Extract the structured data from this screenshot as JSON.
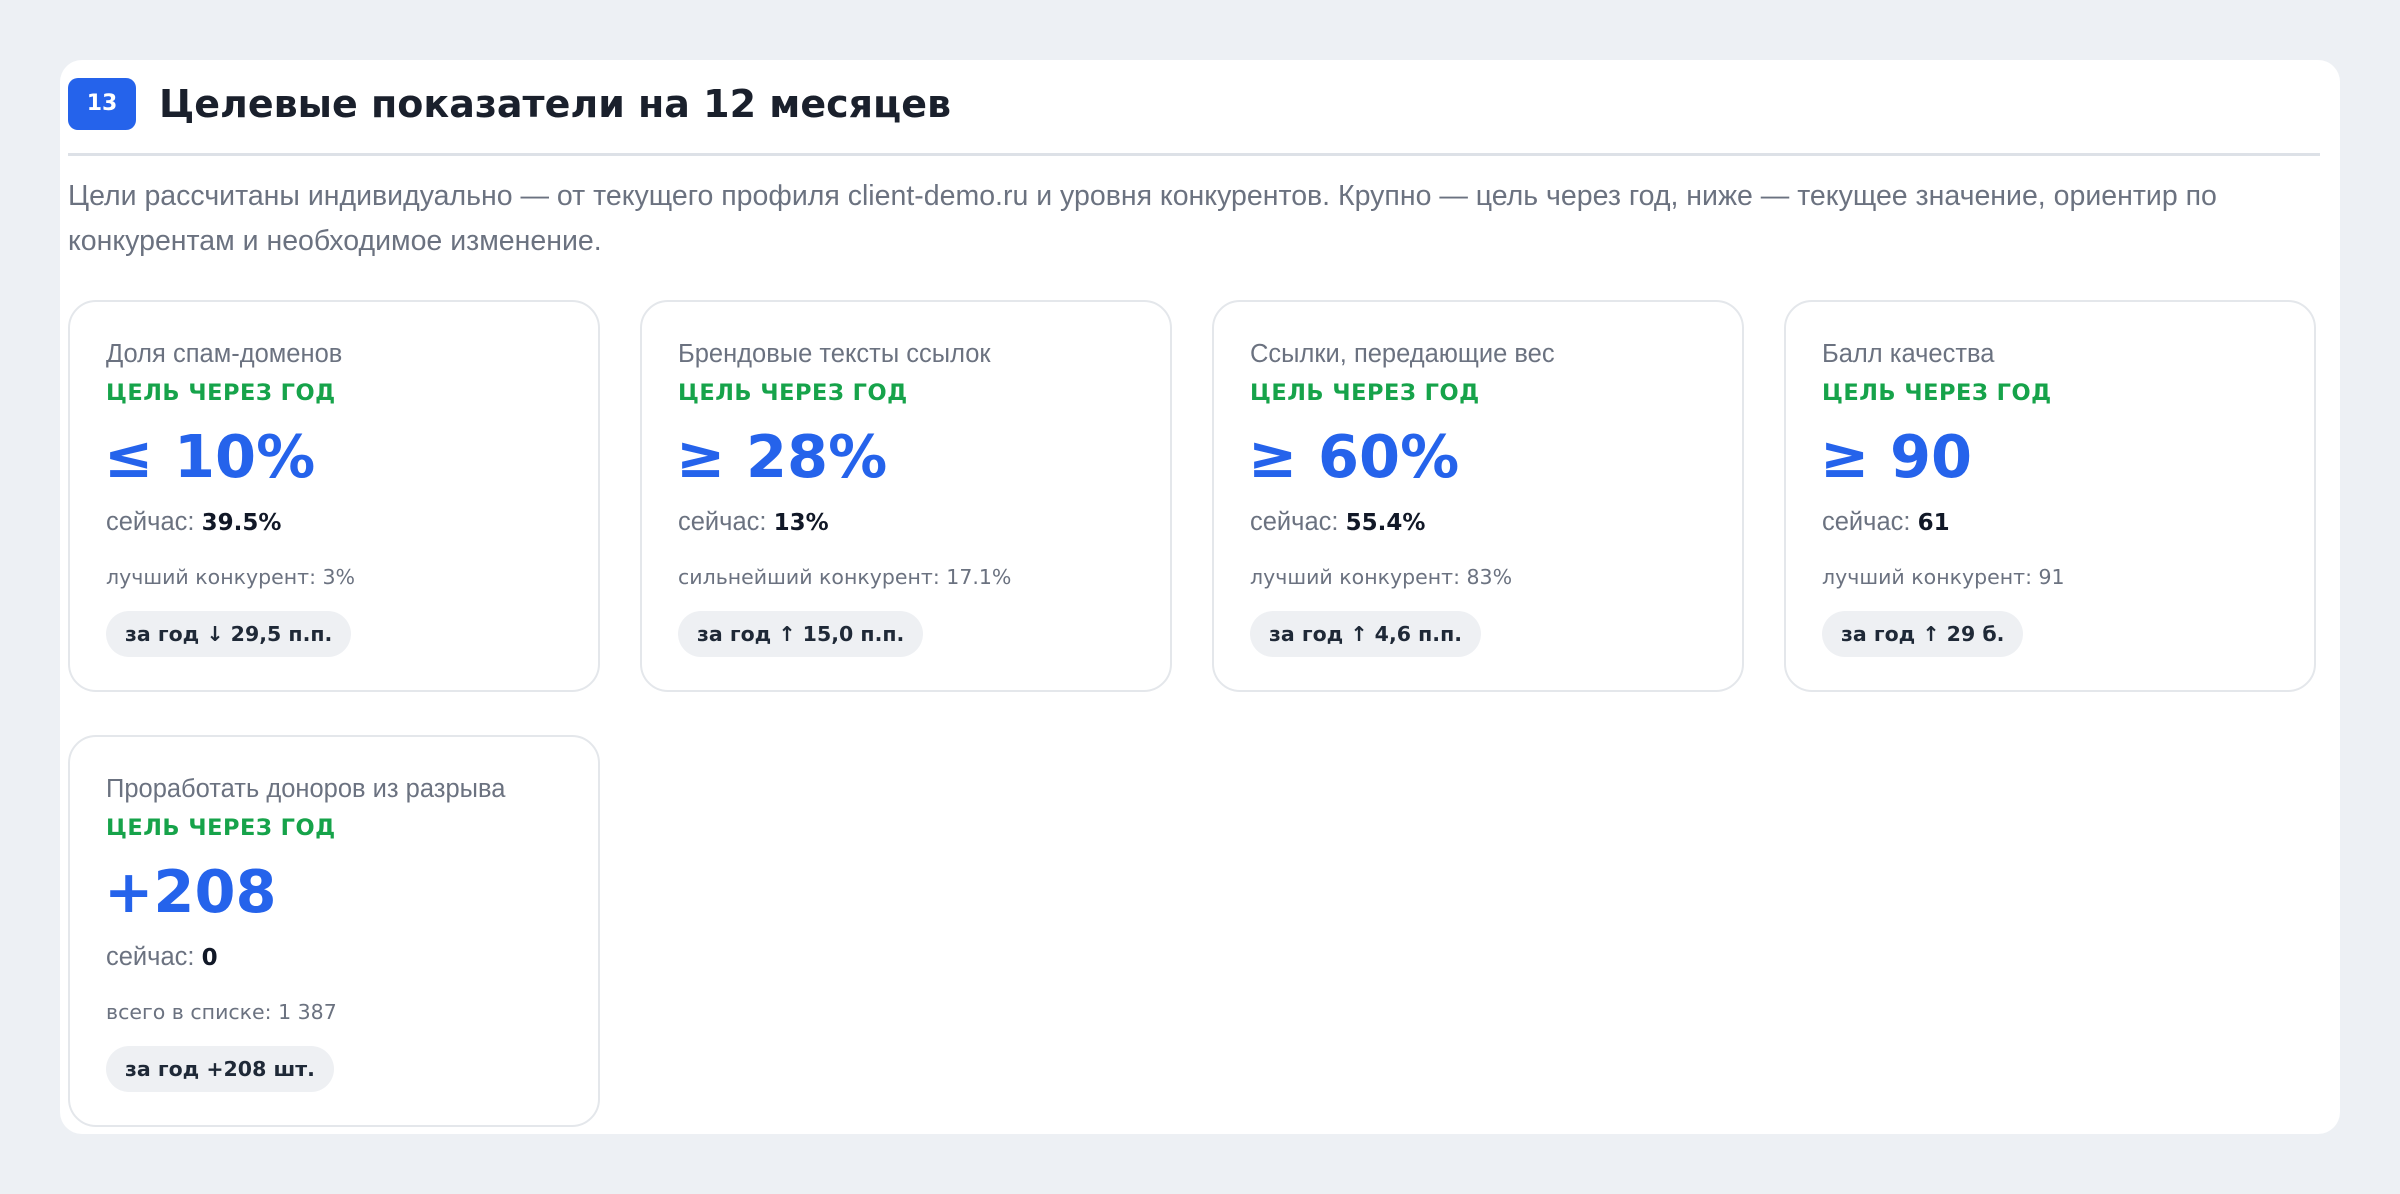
{
  "section": {
    "number": "13",
    "title": "Целевые показатели на 12 месяцев",
    "intro": "Цели рассчитаны индивидуально — от текущего профиля client-demo.ru и уровня конкурентов. Крупно — цель через год, ниже — текущее значение, ориентир по конкурентам и необходимое изменение."
  },
  "colors": {
    "accent": "#2563eb",
    "goal_label": "#16a34a",
    "muted_text": "#6b7280",
    "page_background": "#edf0f4"
  },
  "cards": [
    {
      "label": "Доля спам-доменов",
      "goal_label": "ЦЕЛЬ ЧЕРЕЗ ГОД",
      "target": "≤ 10%",
      "now_prefix": "сейчас:",
      "now_value": "39.5%",
      "benchmark": "лучший конкурент: 3%",
      "delta": "за год ↓ 29,5 п.п."
    },
    {
      "label": "Брендовые тексты ссылок",
      "goal_label": "ЦЕЛЬ ЧЕРЕЗ ГОД",
      "target": "≥ 28%",
      "now_prefix": "сейчас:",
      "now_value": "13%",
      "benchmark": "сильнейший конкурент: 17.1%",
      "delta": "за год ↑ 15,0 п.п."
    },
    {
      "label": "Ссылки, передающие вес",
      "goal_label": "ЦЕЛЬ ЧЕРЕЗ ГОД",
      "target": "≥ 60%",
      "now_prefix": "сейчас:",
      "now_value": "55.4%",
      "benchmark": "лучший конкурент: 83%",
      "delta": "за год ↑ 4,6 п.п."
    },
    {
      "label": "Балл качества",
      "goal_label": "ЦЕЛЬ ЧЕРЕЗ ГОД",
      "target": "≥ 90",
      "now_prefix": "сейчас:",
      "now_value": "61",
      "benchmark": "лучший конкурент: 91",
      "delta": "за год ↑ 29 б."
    },
    {
      "label": "Проработать доноров из разрыва",
      "goal_label": "ЦЕЛЬ ЧЕРЕЗ ГОД",
      "target": "+208",
      "now_prefix": "сейчас:",
      "now_value": "0",
      "benchmark": "всего в списке: 1 387",
      "delta": "за год +208 шт."
    }
  ]
}
